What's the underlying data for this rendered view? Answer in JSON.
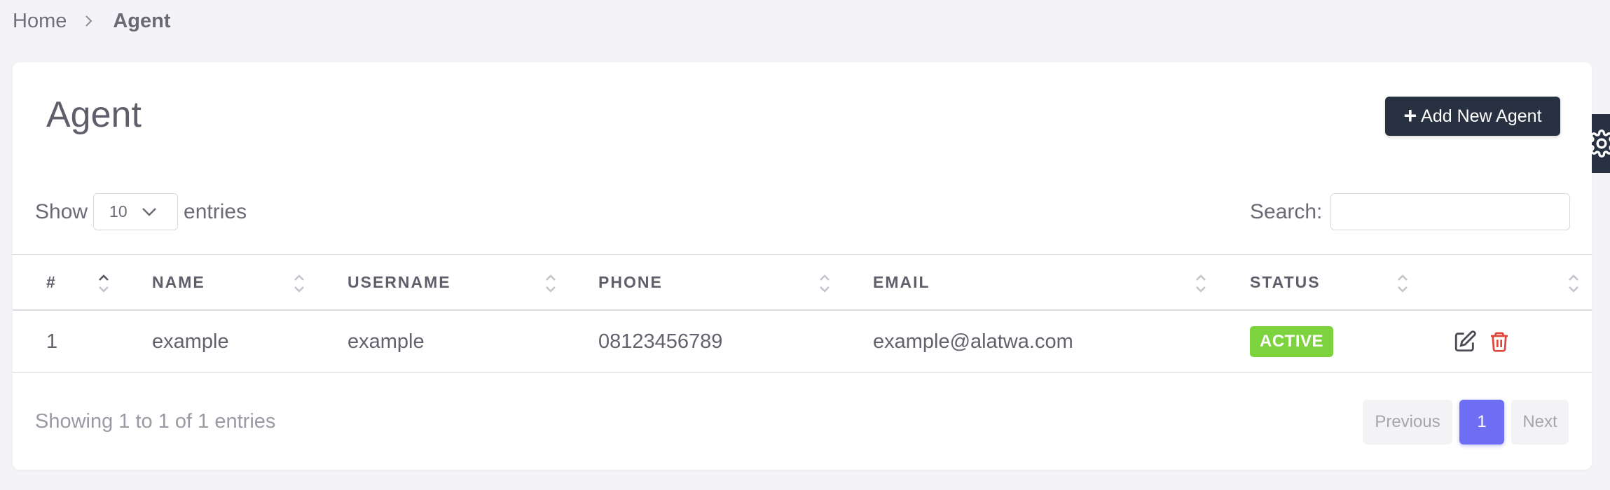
{
  "breadcrumb": {
    "home": "Home",
    "current": "Agent"
  },
  "page": {
    "title": "Agent",
    "add_button": "Add New Agent"
  },
  "length": {
    "show": "Show",
    "value": "10",
    "entries": "entries"
  },
  "search": {
    "label": "Search:",
    "value": ""
  },
  "table": {
    "columns": [
      "#",
      "NAME",
      "USERNAME",
      "PHONE",
      "EMAIL",
      "STATUS",
      ""
    ],
    "rows": [
      {
        "no": "1",
        "name": "example",
        "username": "example",
        "phone": "08123456789",
        "email": "example@alatwa.com",
        "status": "ACTIVE"
      }
    ]
  },
  "footer": {
    "info": "Showing 1 to 1 of 1 entries",
    "previous": "Previous",
    "page": "1",
    "next": "Next"
  },
  "colors": {
    "primary_dark": "#283142",
    "accent": "#6e6ef5",
    "status_active": "#7cd33e",
    "delete": "#e0433a"
  },
  "icons": [
    "chevron-right-icon",
    "plus-icon",
    "chevron-down-icon",
    "sort-icon",
    "edit-icon",
    "trash-icon",
    "gear-icon"
  ]
}
